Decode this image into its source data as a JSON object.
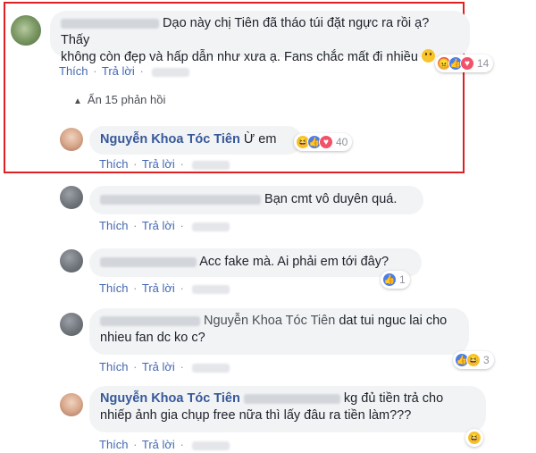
{
  "comments": [
    {
      "text": "Dạo này chị Tiên đã tháo túi đặt ngực ra rồi ạ? Thấy",
      "text2": "không còn đẹp và hấp dẫn như xưa ạ. Fans chắc mất đi nhiều",
      "actions": {
        "like": "Thích",
        "reply": "Trả lời"
      },
      "reaction_count": "14",
      "reactions": [
        "angry-icon",
        "like-icon",
        "love-icon"
      ]
    },
    {
      "name": "Nguyễn Khoa Tóc Tiên",
      "text": "Ừ em",
      "actions": {
        "like": "Thích",
        "reply": "Trả lời"
      },
      "reaction_count": "40",
      "reactions": [
        "haha-icon",
        "like-icon",
        "love-icon"
      ]
    },
    {
      "text": "Bạn cmt vô duyên quá.",
      "actions": {
        "like": "Thích",
        "reply": "Trả lời"
      }
    },
    {
      "text": "Acc fake mà. Ai phải em tới đây?",
      "actions": {
        "like": "Thích",
        "reply": "Trả lời"
      },
      "reaction_count": "1"
    },
    {
      "tag": "Nguyễn Khoa Tóc Tiên",
      "text": "dat tui nguc lai cho",
      "text2": "nhieu fan dc ko c?",
      "actions": {
        "like": "Thích",
        "reply": "Trả lời"
      },
      "reaction_count": "3"
    },
    {
      "name": "Nguyễn Khoa Tóc Tiên",
      "text": "kg đủ tiền trả cho",
      "text2": "nhiếp ảnh gia chụp free nữa thì lấy đâu ra tiền làm???",
      "actions": {
        "like": "Thích",
        "reply": "Trả lời"
      }
    }
  ],
  "replies_toggle": "Ẩn 15 phản hồi",
  "separator": "·"
}
